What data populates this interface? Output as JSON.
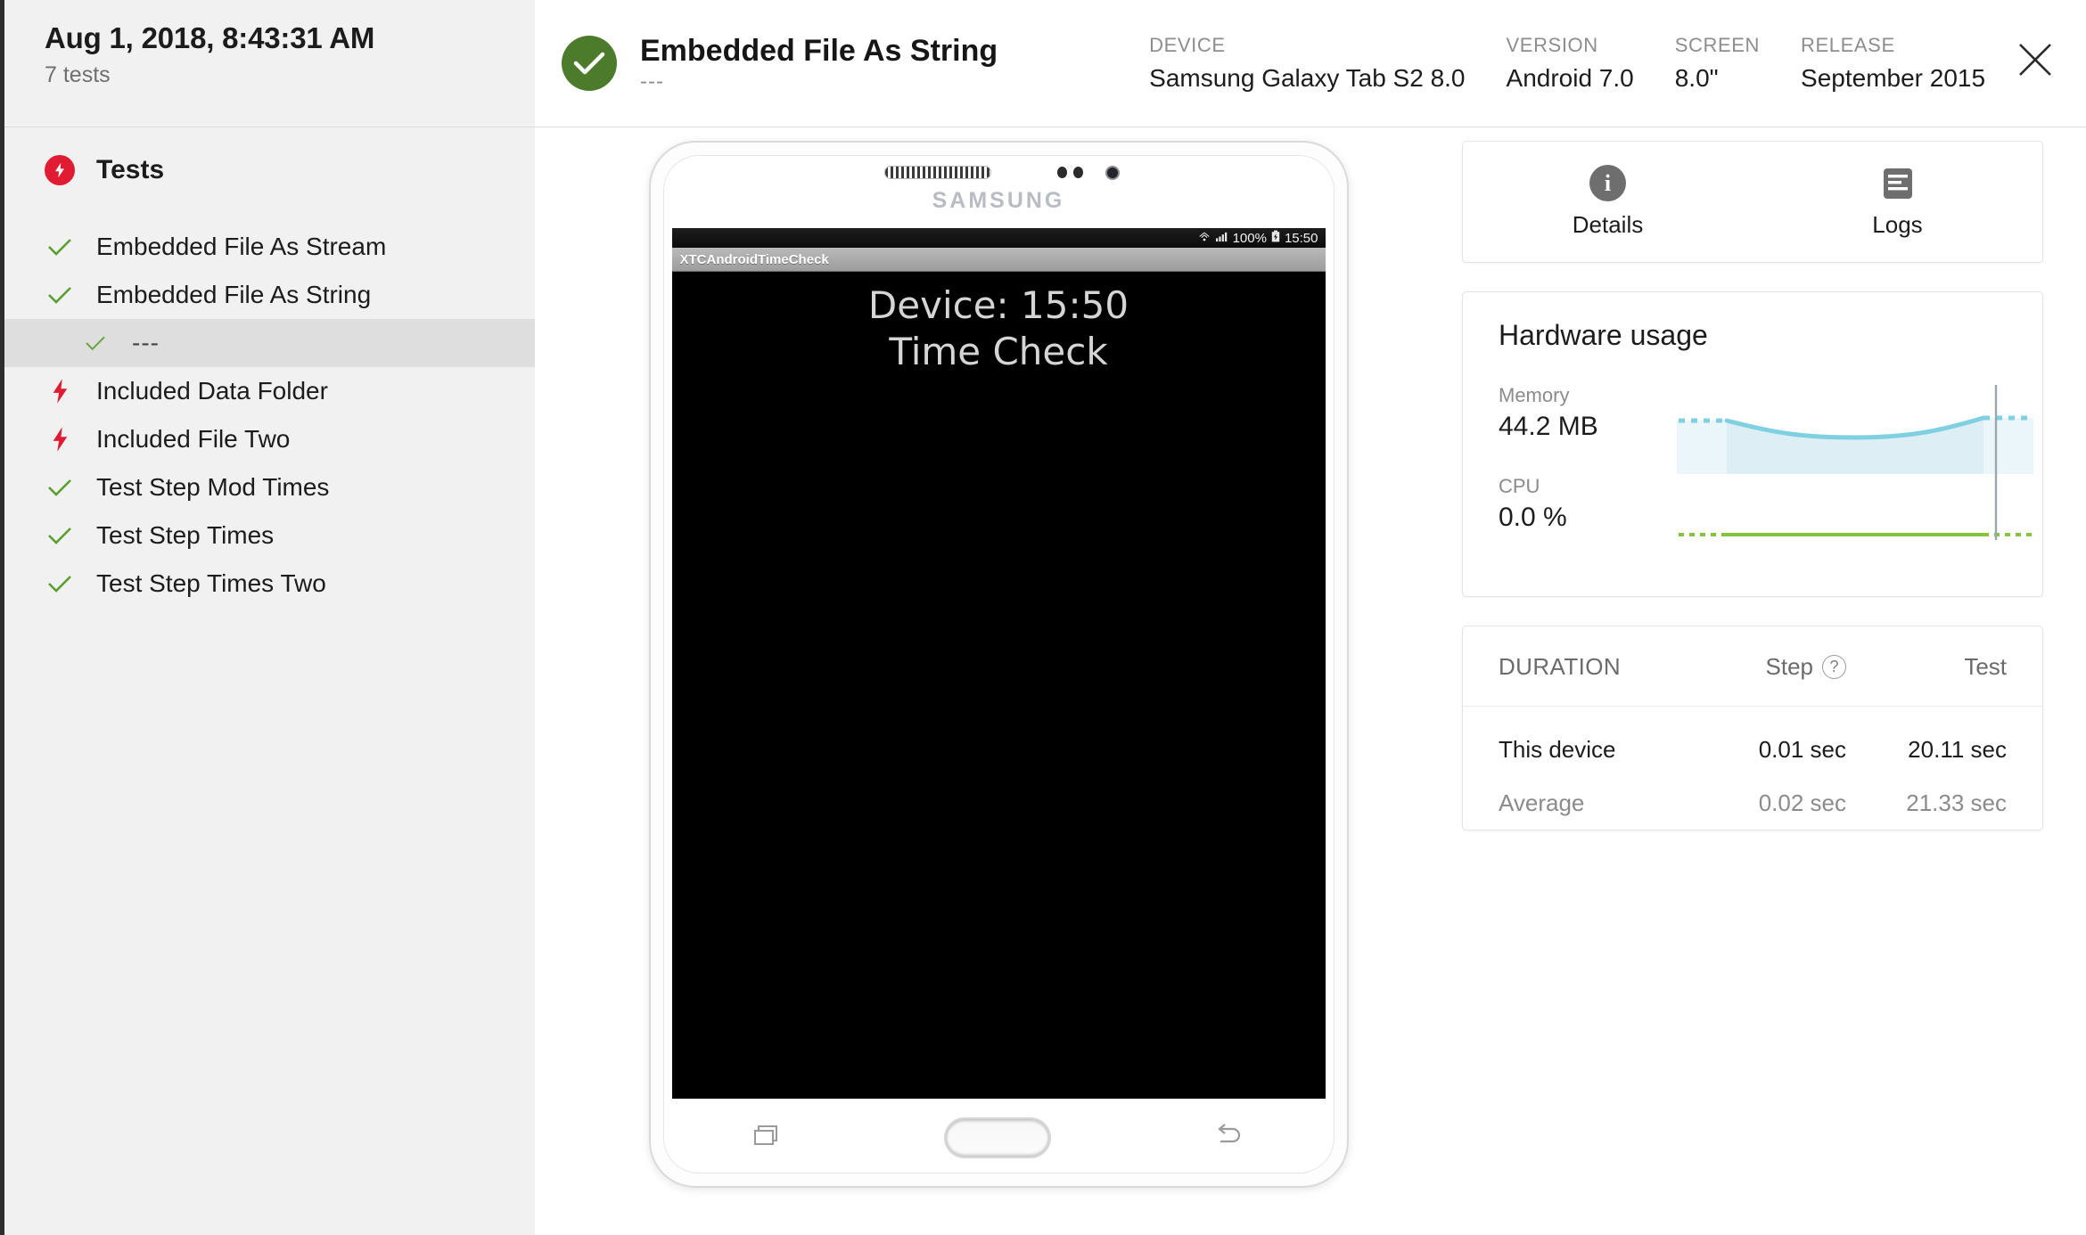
{
  "sidebar": {
    "date": "Aug 1, 2018, 8:43:31 AM",
    "subtitle": "7 tests",
    "group_label": "Tests",
    "group_icon": "bolt-circle-icon",
    "items": [
      {
        "label": "Embedded File As Stream",
        "status": "pass",
        "icon": "check-icon",
        "indent": 0,
        "selected": false
      },
      {
        "label": "Embedded File As String",
        "status": "pass",
        "icon": "check-icon",
        "indent": 0,
        "selected": false
      },
      {
        "label": "---",
        "status": "pass",
        "icon": "check-icon",
        "indent": 1,
        "selected": true
      },
      {
        "label": "Included Data Folder",
        "status": "skipped",
        "icon": "bolt-icon",
        "indent": 0,
        "selected": false
      },
      {
        "label": "Included File Two",
        "status": "skipped",
        "icon": "bolt-icon",
        "indent": 0,
        "selected": false
      },
      {
        "label": "Test Step Mod Times",
        "status": "pass",
        "icon": "check-icon",
        "indent": 0,
        "selected": false
      },
      {
        "label": "Test Step Times",
        "status": "pass",
        "icon": "check-icon",
        "indent": 0,
        "selected": false
      },
      {
        "label": "Test Step Times Two",
        "status": "pass",
        "icon": "check-icon",
        "indent": 0,
        "selected": false
      }
    ]
  },
  "header": {
    "status_icon": "check-circle-icon",
    "title": "Embedded File As String",
    "subtitle": "---",
    "meta": [
      {
        "label": "DEVICE",
        "value": "Samsung Galaxy Tab S2 8.0"
      },
      {
        "label": "VERSION",
        "value": "Android 7.0"
      },
      {
        "label": "SCREEN",
        "value": "8.0\""
      },
      {
        "label": "RELEASE",
        "value": "September 2015"
      }
    ],
    "close_icon": "close-icon"
  },
  "device": {
    "brand": "SAMSUNG",
    "statusbar": {
      "wifi_icon": "wifi-icon",
      "signal_icon": "signal-icon",
      "battery_percent": "100%",
      "battery_icon": "battery-icon",
      "time": "15:50"
    },
    "app_title": "XTCAndroidTimeCheck",
    "screen_lines": [
      "Device: 15:50",
      "Time Check"
    ],
    "nav": {
      "recents_icon": "recents-icon",
      "home_button": "home-button",
      "back_icon": "back-icon"
    }
  },
  "tabs": [
    {
      "label": "Details",
      "icon": "info-icon"
    },
    {
      "label": "Logs",
      "icon": "logs-icon"
    }
  ],
  "hardware": {
    "title": "Hardware usage",
    "memory_label": "Memory",
    "memory_value": "44.2 MB",
    "cpu_label": "CPU",
    "cpu_value": "0.0 %"
  },
  "duration": {
    "title": "DURATION",
    "col_step": "Step",
    "col_step_help_icon": "help-icon",
    "col_test": "Test",
    "rows": [
      {
        "label": "This device",
        "step": "0.01 sec",
        "test": "20.11 sec"
      },
      {
        "label": "Average",
        "step": "0.02 sec",
        "test": "21.33 sec"
      }
    ]
  },
  "colors": {
    "pass_green": "#4c7c2b",
    "fail_red": "#e01b32",
    "check_green": "#5a9e2f",
    "memory_blue": "#7fd0e0",
    "cpu_green": "#86c440",
    "sidebar_bg": "#f1f1f1",
    "selected_bg": "#dedede"
  },
  "chart_data": {
    "type": "area",
    "title": "Hardware usage",
    "series": [
      {
        "name": "Memory",
        "unit": "MB",
        "current_value": 44.2,
        "color": "#7fd0e0",
        "x": [
          0,
          1,
          2,
          3,
          4,
          5,
          6,
          7,
          8,
          9,
          10
        ],
        "values": [
          44.2,
          44.2,
          44.2,
          42.0,
          40.2,
          39.6,
          39.6,
          41.0,
          43.4,
          44.2,
          44.2
        ],
        "solid_range": [
          2,
          9
        ],
        "dotted_ranges": [
          [
            0,
            2
          ],
          [
            9,
            10
          ]
        ]
      },
      {
        "name": "CPU",
        "unit": "%",
        "current_value": 0.0,
        "color": "#86c440",
        "x": [
          0,
          1,
          2,
          3,
          4,
          5,
          6,
          7,
          8,
          9,
          10
        ],
        "values": [
          0,
          0,
          0,
          0,
          0,
          0,
          0,
          0,
          0,
          0,
          0
        ],
        "solid_range": [
          2,
          9
        ],
        "dotted_ranges": [
          [
            0,
            2
          ],
          [
            9,
            10
          ]
        ]
      }
    ],
    "marker_line_x": 9.6,
    "grid": false,
    "legend": "none",
    "xlabel": "",
    "ylabel": ""
  }
}
